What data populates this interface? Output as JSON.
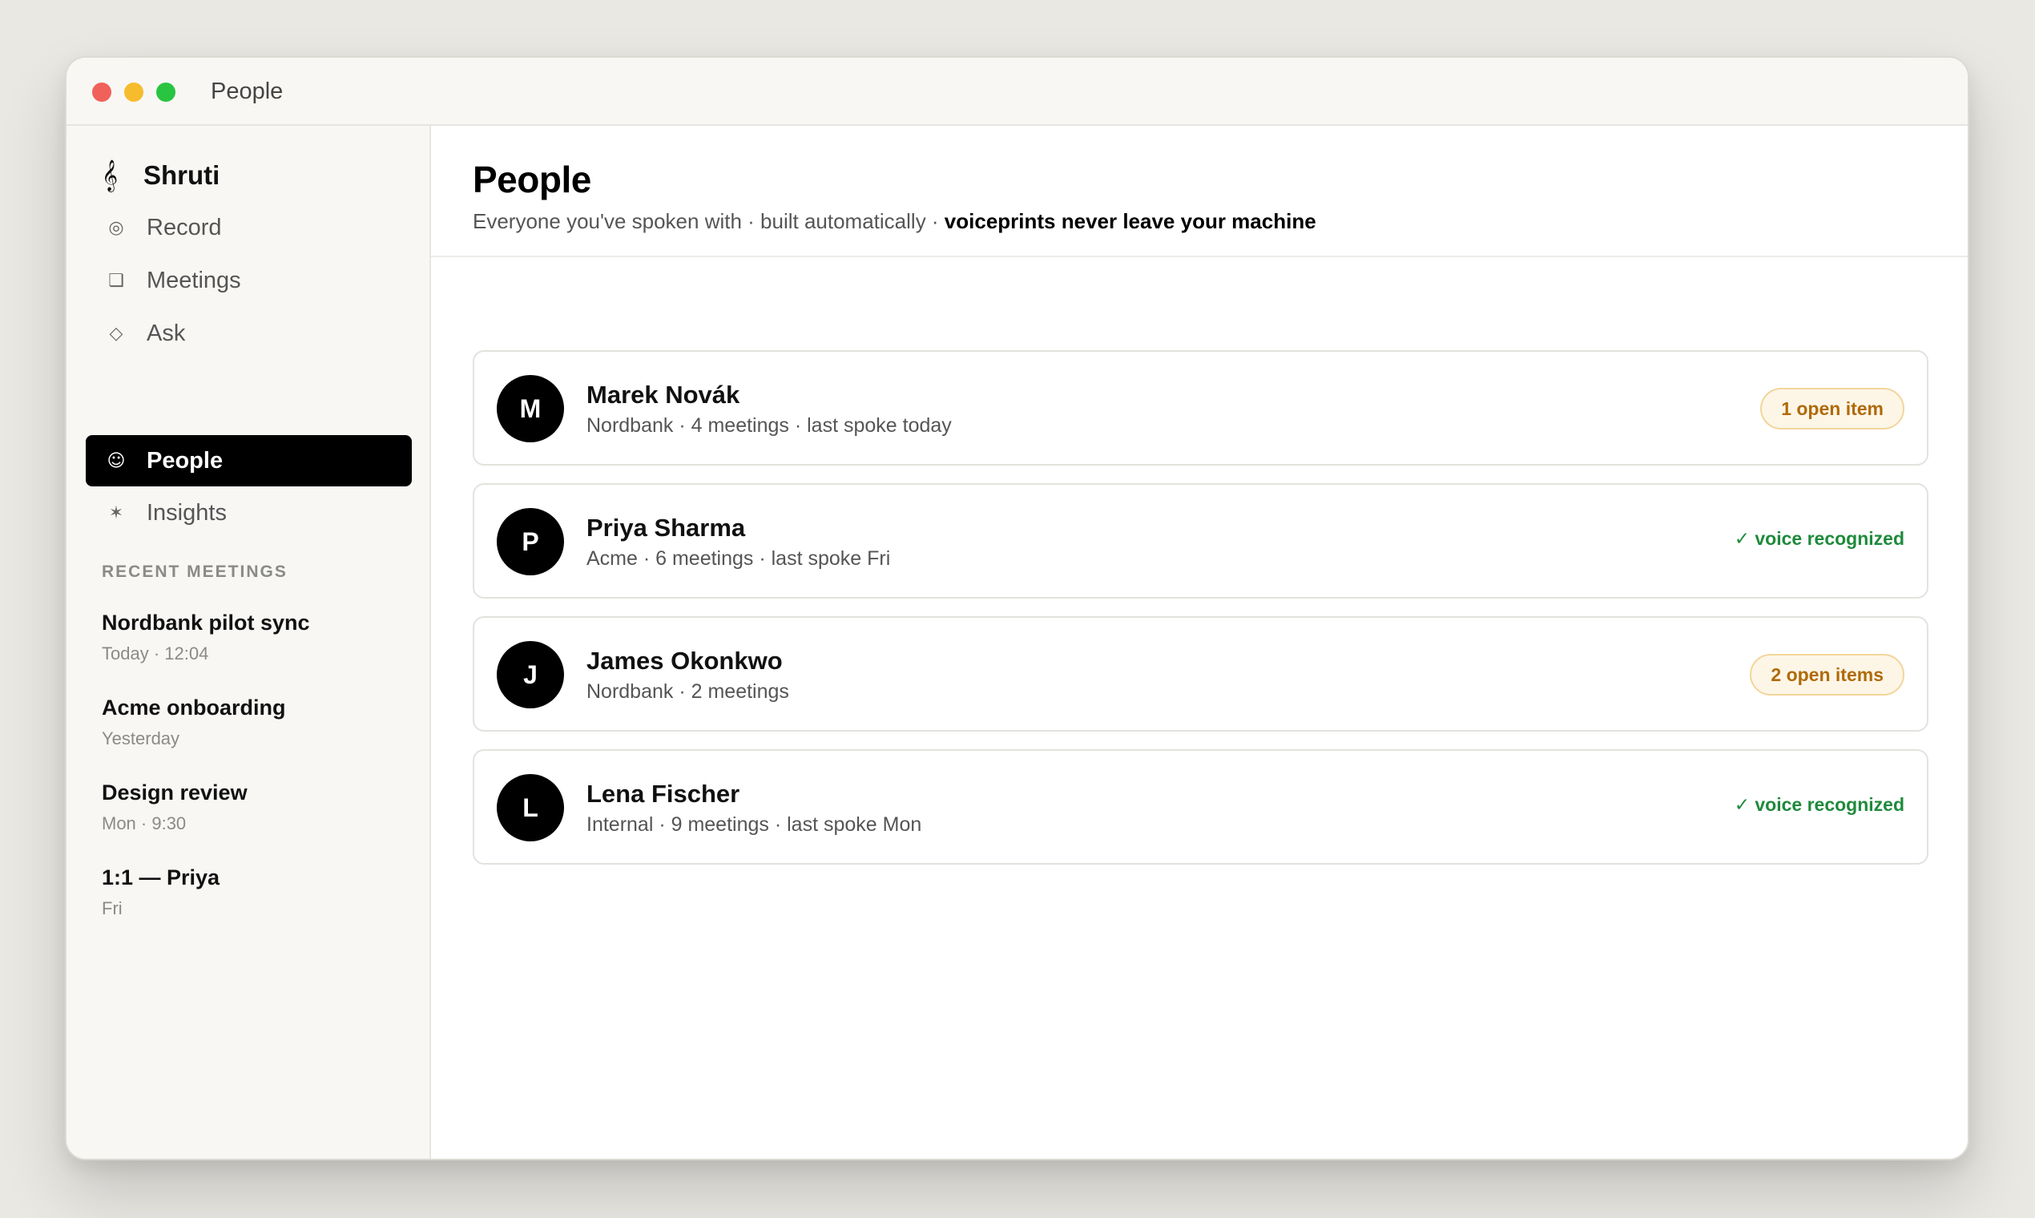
{
  "window": {
    "title": "People"
  },
  "sidebar": {
    "brand": {
      "icon": "treble-clef-icon",
      "name": "Shruti"
    },
    "nav": [
      {
        "icon": "record-icon",
        "label": "Record",
        "active": false
      },
      {
        "icon": "meetings-icon",
        "label": "Meetings",
        "active": false
      },
      {
        "icon": "diamond-icon",
        "label": "Ask",
        "active": false
      },
      {
        "icon": "smiley-icon",
        "label": "People",
        "active": true
      },
      {
        "icon": "sparkle-icon",
        "label": "Insights",
        "active": false
      }
    ],
    "recent_label": "RECENT MEETINGS",
    "recent": [
      {
        "title": "Nordbank pilot sync",
        "time": "Today · 12:04"
      },
      {
        "title": "Acme onboarding",
        "time": "Yesterday"
      },
      {
        "title": "Design review",
        "time": "Mon · 9:30"
      },
      {
        "title": "1:1 — Priya",
        "time": "Fri"
      }
    ]
  },
  "main": {
    "title": "People",
    "subtitle": "Everyone you've spoken with · built automatically · ",
    "subtitle_strong": "voiceprints never leave your machine",
    "people": [
      {
        "initial": "M",
        "name": "Marek Novák",
        "meta": "Nordbank · 4 meetings · last spoke today",
        "badge": "1 open item",
        "badge_type": "open"
      },
      {
        "initial": "P",
        "name": "Priya Sharma",
        "meta": "Acme · 6 meetings · last spoke Fri",
        "badge": "✓ voice recognized",
        "badge_type": "voice"
      },
      {
        "initial": "J",
        "name": "James Okonkwo",
        "meta": "Nordbank · 2 meetings",
        "badge": "2 open items",
        "badge_type": "open"
      },
      {
        "initial": "L",
        "name": "Lena Fischer",
        "meta": "Internal · 9 meetings · last spoke Mon",
        "badge": "✓ voice recognized",
        "badge_type": "voice"
      }
    ]
  },
  "colors": {
    "accent": "#000000",
    "open_badge_text": "#b06a08",
    "open_badge_bg": "#fdf6e7",
    "voice_text": "#1f8a3c"
  }
}
